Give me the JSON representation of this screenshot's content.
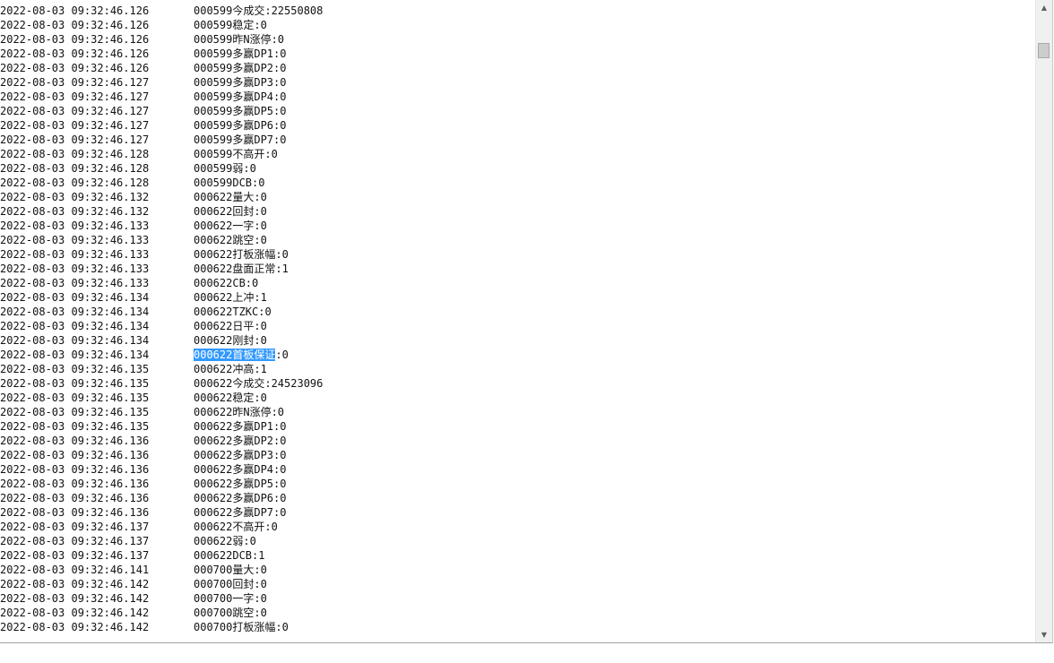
{
  "log": [
    {
      "time": "2022-08-03 09:32:46.126",
      "msg": "000599今成交:22550808"
    },
    {
      "time": "2022-08-03 09:32:46.126",
      "msg": "000599稳定:0"
    },
    {
      "time": "2022-08-03 09:32:46.126",
      "msg": "000599昨N涨停:0"
    },
    {
      "time": "2022-08-03 09:32:46.126",
      "msg": "000599多赢DP1:0"
    },
    {
      "time": "2022-08-03 09:32:46.126",
      "msg": "000599多赢DP2:0"
    },
    {
      "time": "2022-08-03 09:32:46.127",
      "msg": "000599多赢DP3:0"
    },
    {
      "time": "2022-08-03 09:32:46.127",
      "msg": "000599多赢DP4:0"
    },
    {
      "time": "2022-08-03 09:32:46.127",
      "msg": "000599多赢DP5:0"
    },
    {
      "time": "2022-08-03 09:32:46.127",
      "msg": "000599多赢DP6:0"
    },
    {
      "time": "2022-08-03 09:32:46.127",
      "msg": "000599多赢DP7:0"
    },
    {
      "time": "2022-08-03 09:32:46.128",
      "msg": "000599不高开:0"
    },
    {
      "time": "2022-08-03 09:32:46.128",
      "msg": "000599弱:0"
    },
    {
      "time": "2022-08-03 09:32:46.128",
      "msg": "000599DCB:0"
    },
    {
      "time": "2022-08-03 09:32:46.132",
      "msg": "000622量大:0"
    },
    {
      "time": "2022-08-03 09:32:46.132",
      "msg": "000622回封:0"
    },
    {
      "time": "2022-08-03 09:32:46.133",
      "msg": "000622一字:0"
    },
    {
      "time": "2022-08-03 09:32:46.133",
      "msg": "000622跳空:0"
    },
    {
      "time": "2022-08-03 09:32:46.133",
      "msg": "000622打板涨幅:0"
    },
    {
      "time": "2022-08-03 09:32:46.133",
      "msg": "000622盘面正常:1"
    },
    {
      "time": "2022-08-03 09:32:46.133",
      "msg": "000622CB:0"
    },
    {
      "time": "2022-08-03 09:32:46.134",
      "msg": "000622上冲:1"
    },
    {
      "time": "2022-08-03 09:32:46.134",
      "msg": "000622TZKC:0"
    },
    {
      "time": "2022-08-03 09:32:46.134",
      "msg": "000622日平:0"
    },
    {
      "time": "2022-08-03 09:32:46.134",
      "msg": "000622刚封:0"
    },
    {
      "time": "2022-08-03 09:32:46.134",
      "msg_hl": "000622首板保证",
      "msg_rest": ":0"
    },
    {
      "time": "2022-08-03 09:32:46.135",
      "msg": "000622冲高:1"
    },
    {
      "time": "2022-08-03 09:32:46.135",
      "msg": "000622今成交:24523096"
    },
    {
      "time": "2022-08-03 09:32:46.135",
      "msg": "000622稳定:0"
    },
    {
      "time": "2022-08-03 09:32:46.135",
      "msg": "000622昨N涨停:0"
    },
    {
      "time": "2022-08-03 09:32:46.135",
      "msg": "000622多赢DP1:0"
    },
    {
      "time": "2022-08-03 09:32:46.136",
      "msg": "000622多赢DP2:0"
    },
    {
      "time": "2022-08-03 09:32:46.136",
      "msg": "000622多赢DP3:0"
    },
    {
      "time": "2022-08-03 09:32:46.136",
      "msg": "000622多赢DP4:0"
    },
    {
      "time": "2022-08-03 09:32:46.136",
      "msg": "000622多赢DP5:0"
    },
    {
      "time": "2022-08-03 09:32:46.136",
      "msg": "000622多赢DP6:0"
    },
    {
      "time": "2022-08-03 09:32:46.136",
      "msg": "000622多赢DP7:0"
    },
    {
      "time": "2022-08-03 09:32:46.137",
      "msg": "000622不高开:0"
    },
    {
      "time": "2022-08-03 09:32:46.137",
      "msg": "000622弱:0"
    },
    {
      "time": "2022-08-03 09:32:46.137",
      "msg": "000622DCB:1"
    },
    {
      "time": "2022-08-03 09:32:46.141",
      "msg": "000700量大:0"
    },
    {
      "time": "2022-08-03 09:32:46.142",
      "msg": "000700回封:0"
    },
    {
      "time": "2022-08-03 09:32:46.142",
      "msg": "000700一字:0"
    },
    {
      "time": "2022-08-03 09:32:46.142",
      "msg": "000700跳空:0"
    },
    {
      "time": "2022-08-03 09:32:46.142",
      "msg": "000700打板涨幅:0"
    }
  ],
  "scrollbar": {
    "up_icon": "triangle-up-icon",
    "down_icon": "triangle-down-icon",
    "position_fraction": 0.06
  }
}
